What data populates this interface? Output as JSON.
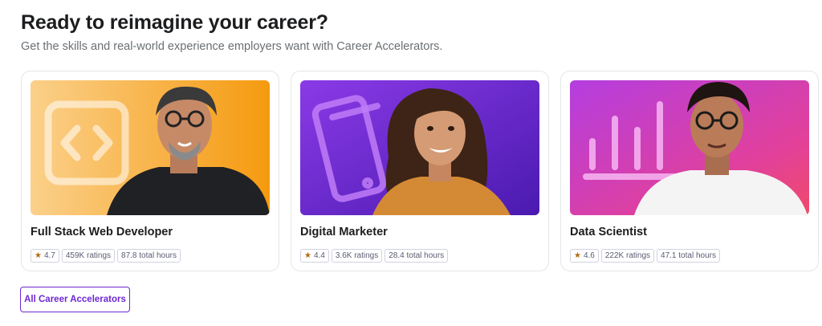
{
  "header": {
    "title": "Ready to reimagine your career?",
    "subtitle": "Get the skills and real-world experience employers want with Career Accelerators."
  },
  "cards": [
    {
      "title": "Full Stack Web Developer",
      "rating": "4.7",
      "ratings_count": "459K ratings",
      "hours": "87.8 total hours",
      "image_bg": "#f7a22a",
      "image_icon": "code-brackets-icon"
    },
    {
      "title": "Digital Marketer",
      "rating": "4.4",
      "ratings_count": "3.6K ratings",
      "hours": "28.4 total hours",
      "image_bg": "#6b2bd1",
      "image_icon": "smartphone-icon"
    },
    {
      "title": "Data Scientist",
      "rating": "4.6",
      "ratings_count": "222K ratings",
      "hours": "47.1 total hours",
      "image_bg": "#c23bd4",
      "image_icon": "bar-chart-icon"
    }
  ],
  "cta": {
    "label": "All Career Accelerators"
  },
  "colors": {
    "accent": "#6d28d2",
    "star": "#b4690e",
    "text": "#1c1d1f",
    "muted": "#6a6f73"
  }
}
